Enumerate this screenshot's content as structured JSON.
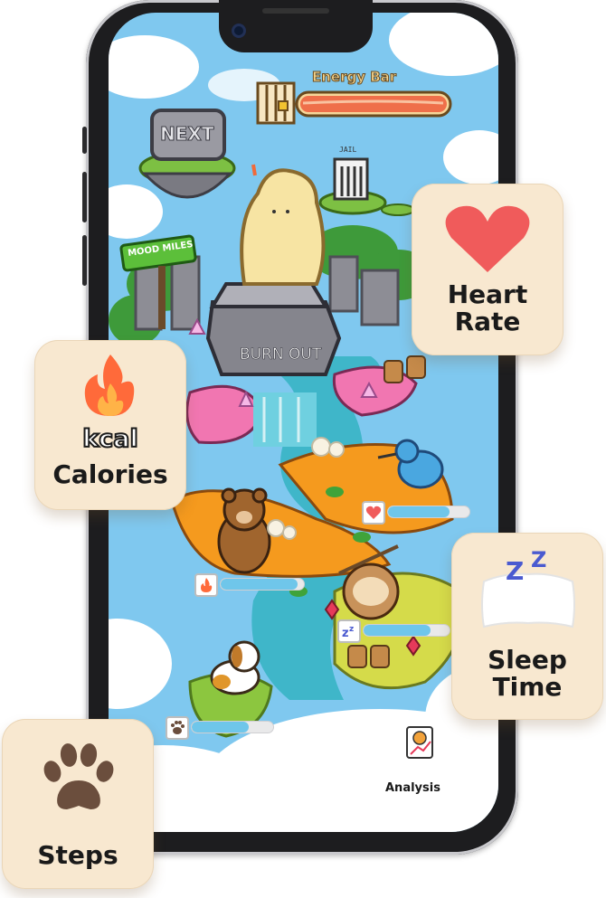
{
  "game": {
    "energy_bar_label": "Energy Bar",
    "energy_level": 1.0,
    "next_sign": "NEXT",
    "jail_sign": "JAIL",
    "mood_sign": "MOOD MILES",
    "rock_label": "BURN OUT",
    "analysis_label": "Analysis"
  },
  "stats": {
    "heart_fill": 0.75,
    "calories_fill": 0.92,
    "sleep_fill": 0.78,
    "steps_fill": 0.7
  },
  "cards": {
    "heart": {
      "line1": "Heart",
      "line2": "Rate",
      "icon": "heart-icon"
    },
    "calories": {
      "kcal": "kcal",
      "label": "Calories",
      "icon": "fire-icon"
    },
    "sleep": {
      "line1": "Sleep",
      "line2": "Time",
      "icon": "pillow-zzz-icon"
    },
    "steps": {
      "label": "Steps",
      "icon": "paw-icon"
    }
  },
  "colors": {
    "sky": "#7fc8ef",
    "card_bg": "#f8e8d0",
    "heart": "#f05b5b",
    "fire": "#ff6a3a",
    "water": "#3fb6c9",
    "bar_fill": "#6fc6ea"
  }
}
